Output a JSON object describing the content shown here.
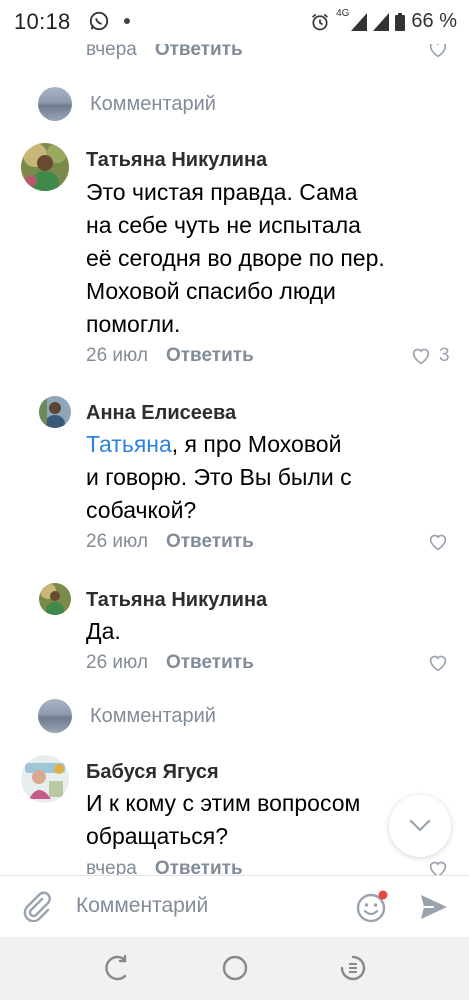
{
  "status_bar": {
    "time": "10:18",
    "network": "4G",
    "battery": "66 %"
  },
  "top_partial": {
    "date": "вчера",
    "reply": "Ответить"
  },
  "comment_link_1": {
    "label": "Комментарий"
  },
  "comments": [
    {
      "author": "Татьяна Никулина",
      "lines": [
        "Это чистая правда. Сама",
        "на себе чуть не испытала",
        "её сегодня во дворе по пер.",
        "Моховой спасибо люди",
        "помогли."
      ],
      "date": "26 июл",
      "reply": "Ответить",
      "likes": "3"
    },
    {
      "author": "Анна Елисеева",
      "mention": "Татьяна",
      "line1_rest": ", я про Моховой",
      "lines": [
        "и говорю. Это Вы были с",
        "собачкой?"
      ],
      "date": "26 июл",
      "reply": "Ответить"
    },
    {
      "author": "Татьяна Никулина",
      "lines": [
        "Да."
      ],
      "date": "26 июл",
      "reply": "Ответить"
    }
  ],
  "comment_link_2": {
    "label": "Комментарий"
  },
  "last_comment": {
    "author": "Бабуся Ягуся",
    "lines": [
      "И к кому с этим вопросом",
      "обращаться?"
    ],
    "date": "вчера",
    "reply": "Ответить"
  },
  "composer": {
    "placeholder": "Комментарий",
    "icons": [
      "paperclip-icon",
      "emoji-icon",
      "send-icon"
    ],
    "accent": "#4986cc",
    "badge_color": "#e64646"
  },
  "navbar": {
    "icons": [
      "back-icon",
      "home-icon",
      "recents-icon"
    ]
  }
}
